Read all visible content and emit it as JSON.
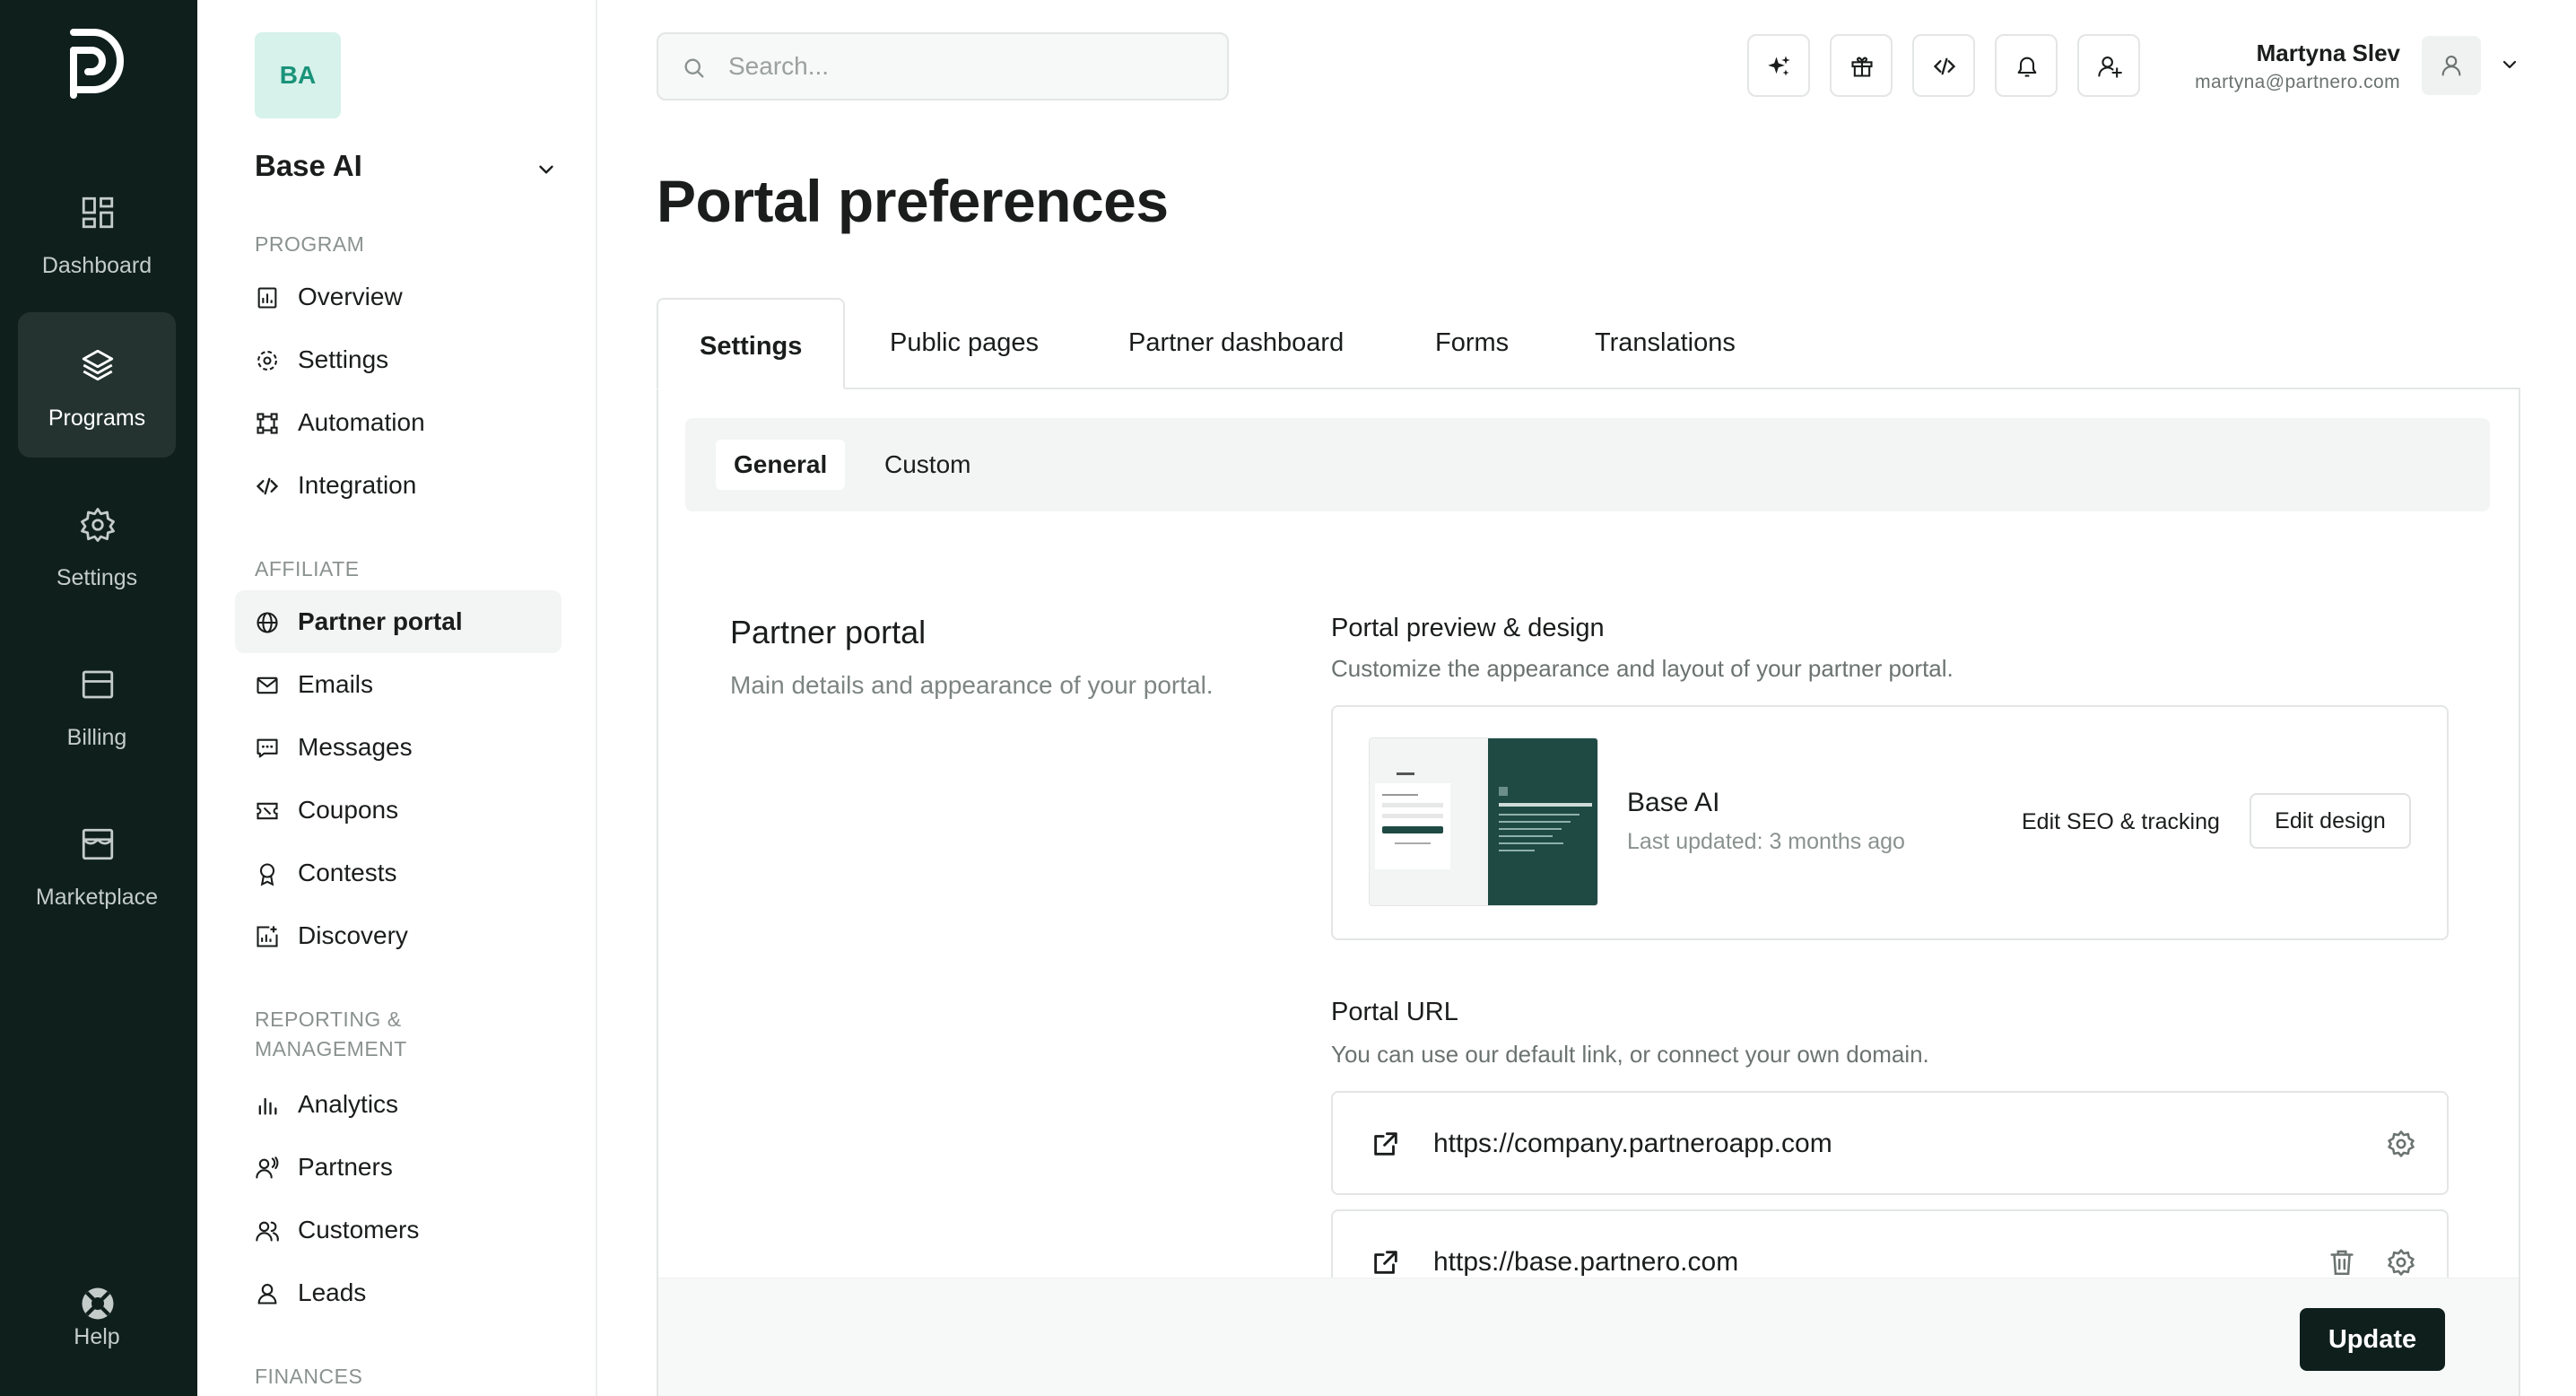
{
  "rail": {
    "items": [
      {
        "label": "Dashboard",
        "icon": "dashboard-grid-icon"
      },
      {
        "label": "Programs",
        "icon": "layers-icon",
        "active": true
      },
      {
        "label": "Settings",
        "icon": "gear-icon"
      },
      {
        "label": "Billing",
        "icon": "credit-card-icon"
      },
      {
        "label": "Marketplace",
        "icon": "store-icon"
      }
    ],
    "help_label": "Help"
  },
  "sidebar": {
    "avatar_initials": "BA",
    "program_name": "Base AI",
    "sections": [
      {
        "heading": "PROGRAM",
        "items": [
          "Overview",
          "Settings",
          "Automation",
          "Integration"
        ]
      },
      {
        "heading": "AFFILIATE",
        "items": [
          "Partner portal",
          "Emails",
          "Messages",
          "Coupons",
          "Contests",
          "Discovery"
        ]
      },
      {
        "heading": "REPORTING & MANAGEMENT",
        "items": [
          "Analytics",
          "Partners",
          "Customers",
          "Leads"
        ]
      },
      {
        "heading": "FINANCES",
        "items": []
      }
    ],
    "active_item": "Partner portal"
  },
  "topbar": {
    "search_placeholder": "Search...",
    "user_name": "Martyna Slev",
    "user_email": "martyna@partnero.com",
    "icons": [
      "sparkles-icon",
      "gift-icon",
      "code-icon",
      "bell-icon",
      "user-plus-icon"
    ]
  },
  "main": {
    "title": "Portal preferences",
    "tabs": [
      "Settings",
      "Public pages",
      "Partner dashboard",
      "Forms",
      "Translations"
    ],
    "active_tab": "Settings",
    "subtabs": [
      "General",
      "Custom"
    ],
    "active_subtab": "General",
    "section": {
      "title": "Partner portal",
      "description": "Main details and appearance of your portal."
    },
    "preview": {
      "title": "Portal preview & design",
      "description": "Customize the appearance and layout of your partner portal.",
      "name": "Base AI",
      "updated": "Last updated: 3 months ago",
      "seo_link": "Edit SEO & tracking",
      "edit_button": "Edit design"
    },
    "portal_url": {
      "title": "Portal URL",
      "description": "You can use our default link, or connect your own domain.",
      "urls": [
        "https://company.partneroapp.com",
        "https://base.partnero.com"
      ]
    },
    "update_button": "Update"
  },
  "colors": {
    "rail_bg": "#0f1f1c",
    "accent": "#19937a",
    "primary_button": "#0f1f1c"
  }
}
